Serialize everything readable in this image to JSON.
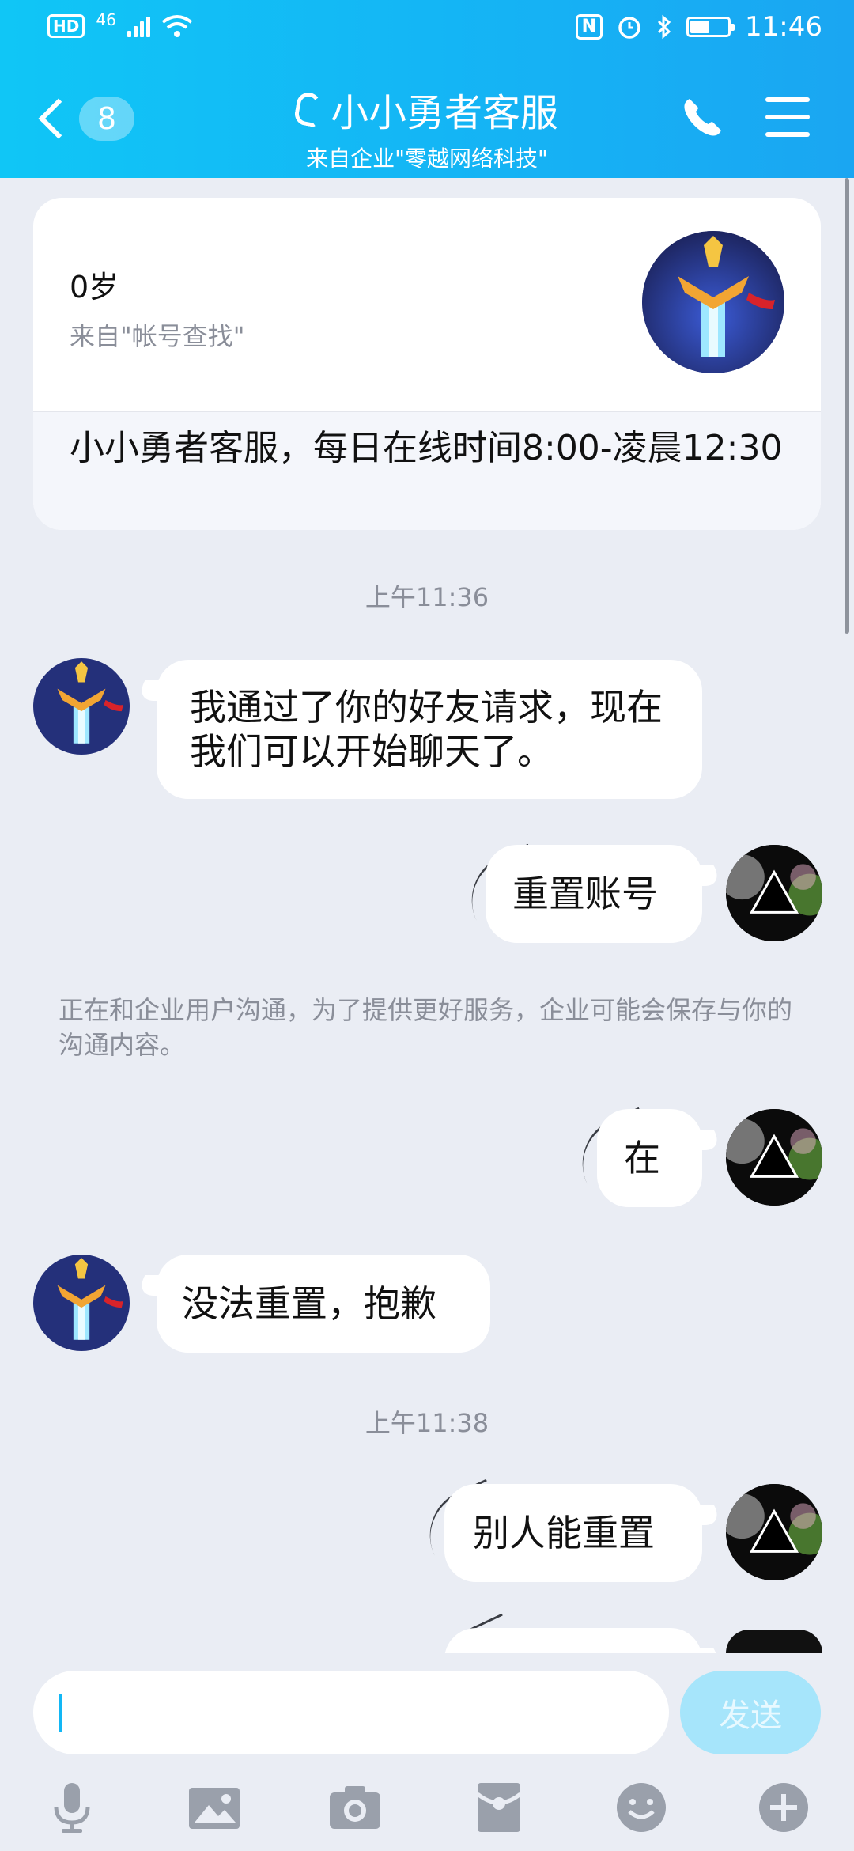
{
  "status_bar": {
    "hd": "HD",
    "signal": "46",
    "time": "11:46",
    "nfc": "N"
  },
  "header": {
    "back_count": "8",
    "title": "小小勇者客服",
    "subtitle": "来自企业\"零越网络科技\""
  },
  "profile_card": {
    "age": "0岁",
    "source": "来自\"帐号查找\"",
    "description": " 小小勇者客服，每日在线时间8:00-凌晨12:30"
  },
  "messages": [
    {
      "type": "timestamp",
      "text": "上午11:36"
    },
    {
      "type": "received",
      "text": "我通过了你的好友请求，现在我们可以开始聊天了。"
    },
    {
      "type": "sent",
      "text": "重置账号"
    },
    {
      "type": "notice",
      "text": "正在和企业用户沟通，为了提供更好服务，企业可能会保存与你的沟通内容。"
    },
    {
      "type": "sent",
      "text": "在"
    },
    {
      "type": "received",
      "text": "没法重置，抱歉"
    },
    {
      "type": "timestamp",
      "text": "上午11:38"
    },
    {
      "type": "sent",
      "text": "别人能重置"
    }
  ],
  "input": {
    "placeholder": "",
    "send_label": "发送"
  },
  "toolbar": [
    "microphone-icon",
    "image-icon",
    "camera-icon",
    "red-envelope-icon",
    "emoji-icon",
    "plus-icon"
  ],
  "colors": {
    "header": "#14b6f5",
    "background": "#eaedf4",
    "send_button": "#a6e5fb"
  }
}
